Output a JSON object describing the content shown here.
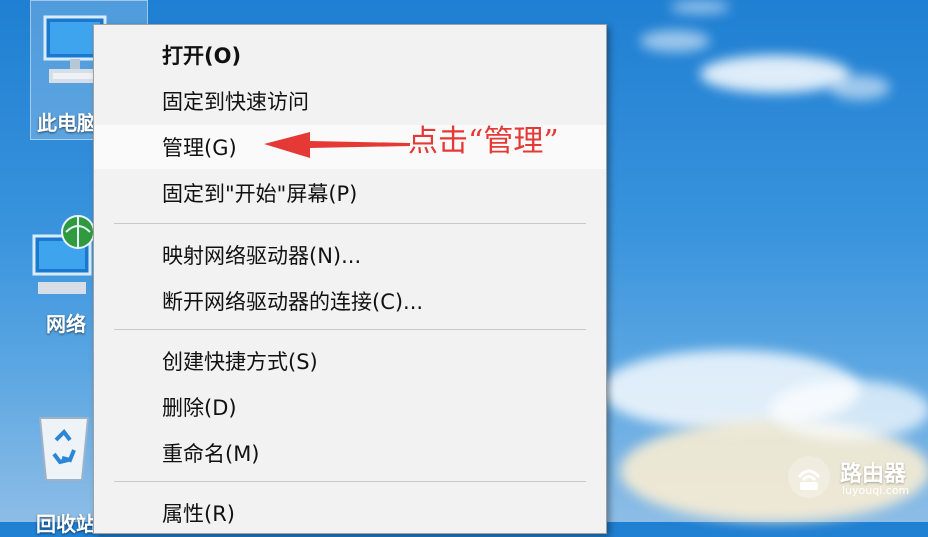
{
  "desktop": {
    "icons": [
      {
        "label": "此电脑"
      },
      {
        "label": "网络"
      },
      {
        "label": "回收站"
      }
    ]
  },
  "context_menu": {
    "items": [
      {
        "label": "打开(O)"
      },
      {
        "label": "固定到快速访问"
      },
      {
        "label": "管理(G)"
      },
      {
        "label": "固定到\"开始\"屏幕(P)"
      },
      {
        "label": "映射网络驱动器(N)..."
      },
      {
        "label": "断开网络驱动器的连接(C)..."
      },
      {
        "label": "创建快捷方式(S)"
      },
      {
        "label": "删除(D)"
      },
      {
        "label": "重命名(M)"
      },
      {
        "label": "属性(R)"
      }
    ]
  },
  "annotation": {
    "text": "点击“管理”",
    "color": "#e53935"
  },
  "watermark": {
    "title": "路由器",
    "url": "luyouqi.com"
  }
}
